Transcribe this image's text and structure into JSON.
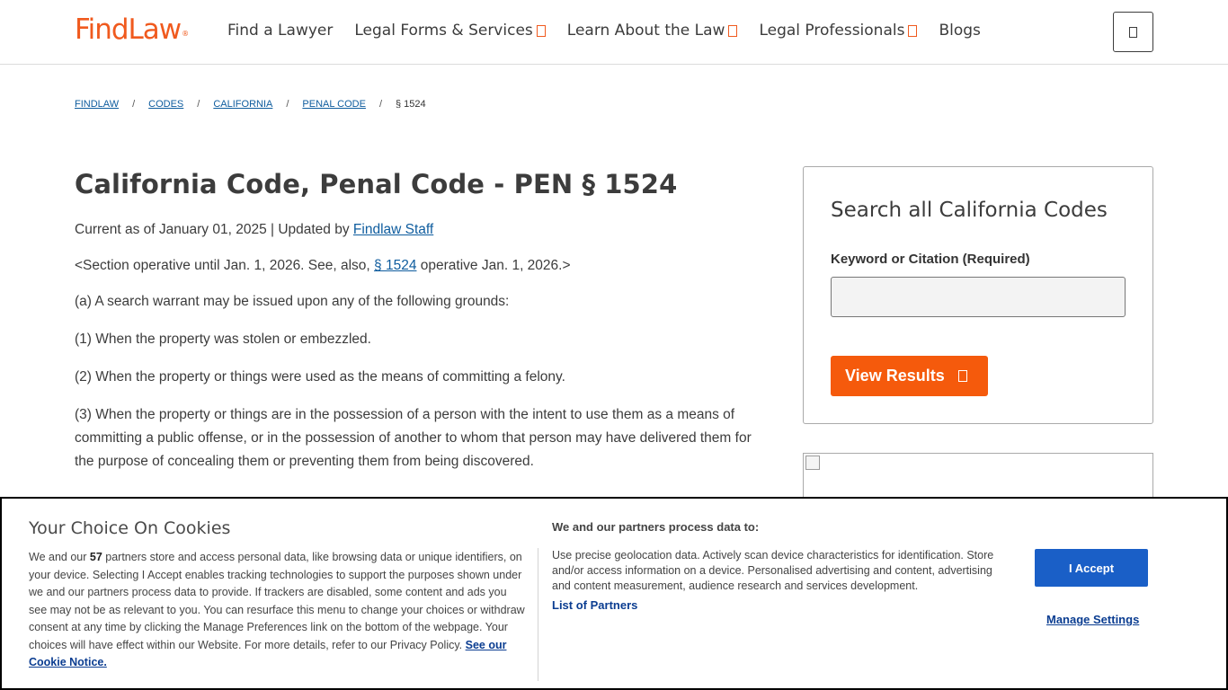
{
  "header": {
    "logo": "FindLaw",
    "logo_mark": "®",
    "nav": [
      {
        "label": "Find a Lawyer",
        "has_caret": false
      },
      {
        "label": "Legal Forms & Services",
        "has_caret": true
      },
      {
        "label": "Learn About the Law",
        "has_caret": true
      },
      {
        "label": "Legal Professionals",
        "has_caret": true
      },
      {
        "label": "Blogs",
        "has_caret": false
      }
    ],
    "menu_icon": "menu-icon"
  },
  "breadcrumb": {
    "items": [
      "FINDLAW",
      "CODES",
      "CALIFORNIA",
      "PENAL CODE"
    ],
    "separator": "/",
    "current": "§ 1524"
  },
  "article": {
    "title": "California Code, Penal Code - PEN § 1524",
    "meta_prefix": "Current as of January 01, 2025 | Updated by ",
    "meta_author": "Findlaw Staff",
    "note_prefix": "<Section operative until Jan. 1, 2026. See, also, ",
    "note_link": "§ 1524",
    "note_suffix": " operative Jan. 1, 2026.>",
    "p_a": "(a) A search warrant may be issued upon any of the following grounds:",
    "p1": "(1) When the property was stolen or embezzled.",
    "p2": "(2) When the property or things were used as the means of committing a felony.",
    "p3": "(3) When the property or things are in the possession of a person with the intent to use them as a means of committing a public offense, or in the possession of another to whom that person may have delivered them for the purpose of concealing them or preventing them from being discovered."
  },
  "search": {
    "title": "Search all California Codes",
    "label": "Keyword or Citation (Required)",
    "input_value": "",
    "button": "View Results"
  },
  "cookie": {
    "title": "Your Choice On Cookies",
    "body_1": "We and our ",
    "partner_count": "57",
    "body_2": " partners store and access personal data, like browsing data or unique identifiers, on your device. Selecting I Accept enables tracking technologies to support the purposes shown under we and our partners process data to provide. If trackers are disabled, some content and ads you see may not be as relevant to you. You can resurface this menu to change your choices or withdraw consent at any time by clicking the Manage Preferences link on the bottom of the webpage. Your choices will have effect within our Website. For more details, refer to our Privacy Policy. ",
    "notice_link": "See our Cookie Notice.",
    "purposes_title": "We and our partners process data to:",
    "purposes": "Use precise geolocation data. Actively scan device characteristics for identification. Store and/or access information on a device. Personalised advertising and content, advertising and content measurement, audience research and services development.",
    "partners_link": "List of Partners",
    "accept": "I Accept",
    "manage": "Manage Settings"
  },
  "colors": {
    "brand_orange": "#f05a1e",
    "button_orange": "#f55a0c",
    "link_blue": "#0e5c9e",
    "accept_blue": "#1a5fc7"
  }
}
